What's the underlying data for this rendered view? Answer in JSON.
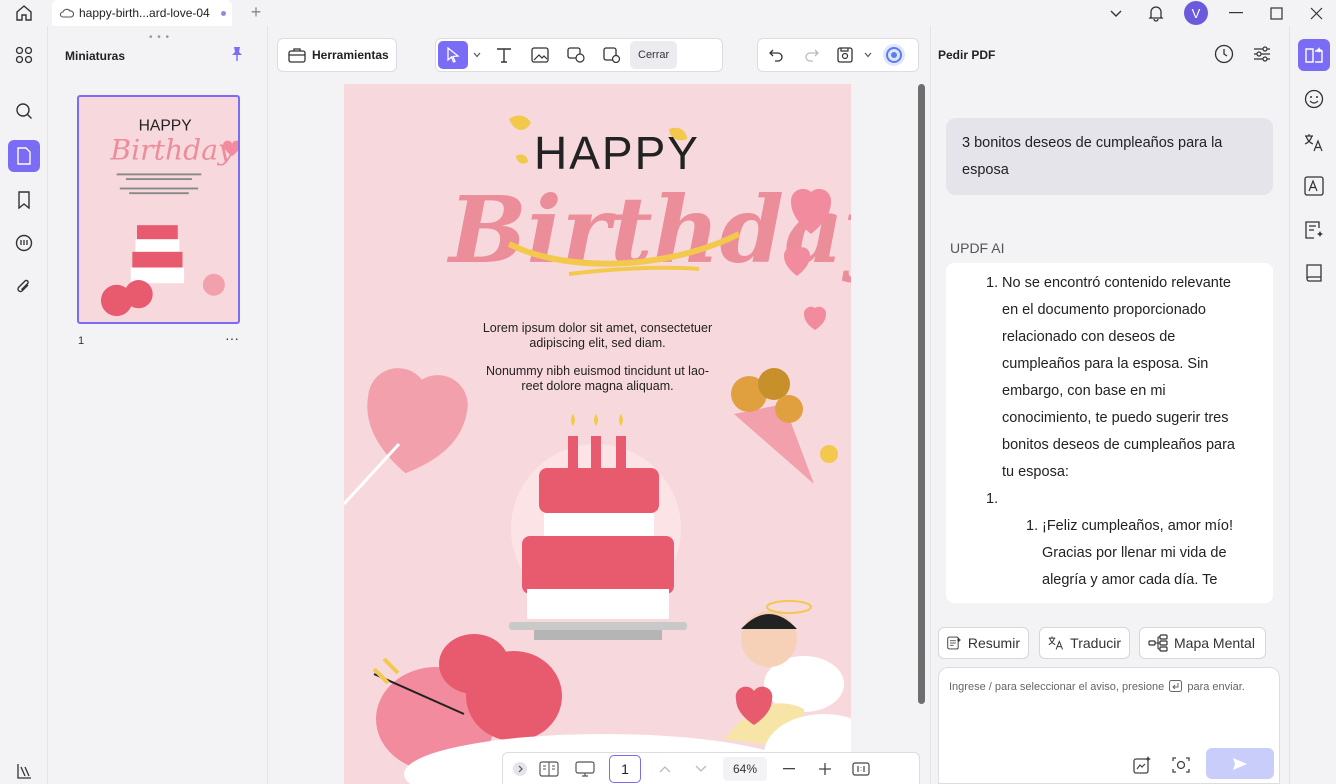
{
  "tab": {
    "title": "happy-birth...ard-love-04"
  },
  "user": {
    "avatar_letter": "V"
  },
  "thumbs": {
    "title": "Miniaturas",
    "page_number": "1",
    "more": "···"
  },
  "toolbar": {
    "tools_label": "Herramientas",
    "close_label": "Cerrar"
  },
  "document": {
    "title_top": "HAPPY",
    "title_script": "Birthday",
    "para1_line1": "Lorem ipsum dolor sit amet, consectetuer",
    "para1_line2": "adipiscing elit, sed diam.",
    "para2_line1": "Nonummy nibh euismod tincidunt ut lao-",
    "para2_line2": "reet dolore magna aliquam."
  },
  "docbar": {
    "page": "1",
    "zoom": "64%"
  },
  "ai": {
    "header": "Pedir PDF",
    "user_prompt": "3  bonitos deseos de cumpleaños para la esposa",
    "assistant_label": "UPDF AI",
    "answer": {
      "item1_number": "1.",
      "item1_lines": [
        "No se encontró contenido relevante",
        "en el documento proporcionado",
        "relacionado con deseos de",
        "cumpleaños para la esposa. Sin",
        "embargo, con base en mi",
        "conocimiento, te puedo sugerir tres",
        "bonitos deseos de cumpleaños para",
        "tu esposa:"
      ],
      "item2_number": "1.",
      "sub1_number": "1.",
      "sub1_lines": [
        "¡Feliz cumpleaños, amor mío!",
        "Gracias por llenar mi vida de",
        "alegría y amor cada día. Te"
      ]
    },
    "actions": {
      "summarize": "Resumir",
      "translate": "Traducir",
      "mindmap": "Mapa Mental"
    },
    "input": {
      "placeholder_before": "Ingrese / para seleccionar el aviso, presione",
      "placeholder_after": "para enviar."
    }
  },
  "colors": {
    "accent": "#7b6cf6",
    "page_bg": "#f7d9dd",
    "cake_pink": "#e85a6e",
    "title_pink": "#ec8d9a",
    "gold": "#f2c94c"
  }
}
